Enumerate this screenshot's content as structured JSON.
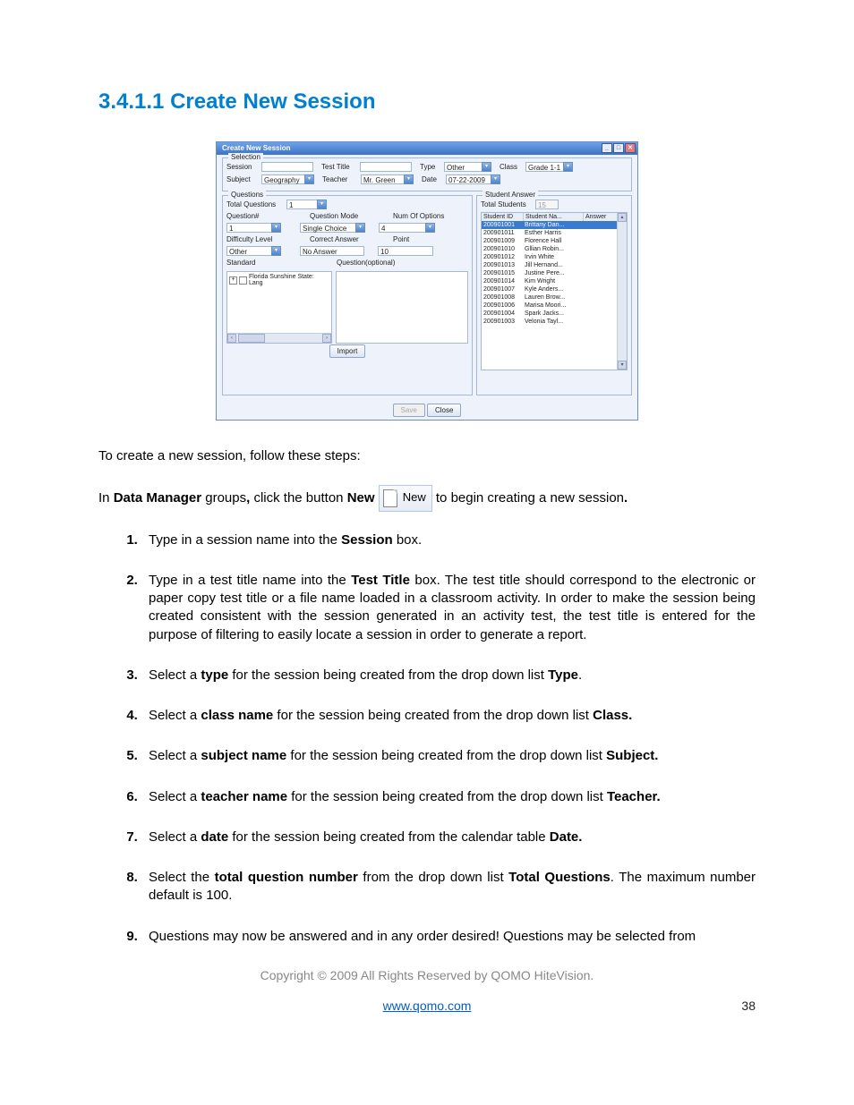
{
  "heading": "3.4.1.1 Create New Session",
  "dialog": {
    "title": "Create New Session",
    "selection": {
      "legend": "Selection",
      "session_lbl": "Session",
      "session_val": "",
      "testtitle_lbl": "Test Title",
      "testtitle_val": "",
      "type_lbl": "Type",
      "type_val": "Other",
      "class_lbl": "Class",
      "class_val": "Grade 1-1",
      "subject_lbl": "Subject",
      "subject_val": "Geography",
      "teacher_lbl": "Teacher",
      "teacher_val": "Mr. Green",
      "date_lbl": "Date",
      "date_val": "07-22-2009"
    },
    "questions": {
      "legend": "Questions",
      "totalq_lbl": "Total Questions",
      "totalq_val": "1",
      "qnum_lbl": "Question#",
      "qnum_val": "1",
      "qmode_lbl": "Question Mode",
      "qmode_val": "Single Choice",
      "numopt_lbl": "Num Of Options",
      "numopt_val": "4",
      "diff_lbl": "Difficulty Level",
      "diff_val": "Other",
      "correct_lbl": "Correct Answer",
      "correct_val": "No Answer",
      "point_lbl": "Point",
      "point_val": "10",
      "standard_lbl": "Standard",
      "qopt_lbl": "Question(optional)",
      "tree_item": "Florida Sunshine State: Lang",
      "import_btn": "Import"
    },
    "answers": {
      "legend": "Student Answer",
      "totals_lbl": "Total Students",
      "totals_val": "15",
      "col_id": "Student ID",
      "col_name": "Student Na...",
      "col_ans": "Answer",
      "rows": [
        {
          "id": "200901001",
          "name": "Brittany Dan..."
        },
        {
          "id": "200901011",
          "name": "Esther Harris"
        },
        {
          "id": "200901009",
          "name": "Florence Hall"
        },
        {
          "id": "200901010",
          "name": "Gllian Robin..."
        },
        {
          "id": "200901012",
          "name": "Irvin White"
        },
        {
          "id": "200901013",
          "name": "Jill  Hernand..."
        },
        {
          "id": "200901015",
          "name": "Justine Pere..."
        },
        {
          "id": "200901014",
          "name": "Kim Wright"
        },
        {
          "id": "200901007",
          "name": "Kyle Anders..."
        },
        {
          "id": "200901008",
          "name": "Lauren Brow..."
        },
        {
          "id": "200901006",
          "name": "Marisa Moori..."
        },
        {
          "id": "200901004",
          "name": "Spark Jacks..."
        },
        {
          "id": "200901003",
          "name": "Velonia Tayl..."
        }
      ]
    },
    "save_btn": "Save",
    "close_btn": "Close"
  },
  "intro_text": "To create a new session, follow these steps:",
  "new_btn_paragraph": {
    "prefix1": "In ",
    "bold1": "Data Manager",
    "mid1": " groups",
    "bold_comma": ",",
    "mid2": " click the button ",
    "bold2": "New",
    "new_label": "New",
    "suffix": " to begin creating a new session",
    "dot": "."
  },
  "steps": [
    {
      "n": "Type in a session name into the ",
      "b": "Session",
      "r": " box."
    },
    {
      "n": "Type in a test title name into the ",
      "b": "Test Title",
      "r": " box. The test title should correspond to the electronic or paper copy test title or a file name loaded in a classroom activity. In order to make the session being created consistent with the session generated in an activity test, the test title is entered for the purpose of filtering to easily locate a session in order to generate a report."
    },
    {
      "n": "Select a ",
      "b": "type",
      "r": " for the session being created from the drop down list ",
      "b2": "Type",
      "r2": "."
    },
    {
      "n": "Select a ",
      "b": "class name",
      "r": " for the session being created from the drop down list ",
      "b2": "Class.",
      "r2": ""
    },
    {
      "n": "Select a ",
      "b": "subject name",
      "r": " for the session being created from the drop down list ",
      "b2": "Subject.",
      "r2": ""
    },
    {
      "n": "Select a ",
      "b": "teacher name",
      "r": " for the session being created from the drop down list ",
      "b2": "Teacher.",
      "r2": ""
    },
    {
      "n": "Select a ",
      "b": "date",
      "r": " for the session being created from the calendar table ",
      "b2": "Date.",
      "r2": ""
    },
    {
      "n": "Select the ",
      "b": "total question number",
      "r": " from the drop down list ",
      "b2": "Total Questions",
      "r2": ". The maximum number default is 100."
    },
    {
      "n": "Questions may now be answered and in any order desired! Questions may be selected from",
      "b": "",
      "r": ""
    }
  ],
  "copyright": "Copyright © 2009 All Rights Reserved by QOMO HiteVision.",
  "url": "www.qomo.com",
  "page_num": "38"
}
